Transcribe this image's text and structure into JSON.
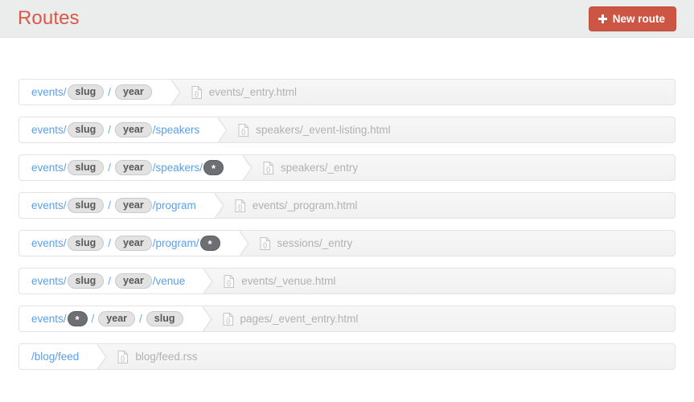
{
  "header": {
    "title": "Routes",
    "new_route_label": "New route",
    "plus_icon": "plus-icon",
    "accent_color": "#d9584a",
    "button_color": "#cd5543",
    "background_color": "#ebecec"
  },
  "icons": {
    "template_file": "template-file-icon",
    "wildcard": "*"
  },
  "routes": [
    {
      "segments": [
        {
          "type": "text",
          "value": "events/"
        },
        {
          "type": "var",
          "value": "slug"
        },
        {
          "type": "sep",
          "value": "/"
        },
        {
          "type": "var",
          "value": "year"
        }
      ],
      "template": "events/_entry.html"
    },
    {
      "segments": [
        {
          "type": "text",
          "value": "events/"
        },
        {
          "type": "var",
          "value": "slug"
        },
        {
          "type": "sep",
          "value": "/"
        },
        {
          "type": "var",
          "value": "year"
        },
        {
          "type": "text",
          "value": "/speakers"
        }
      ],
      "template": "speakers/_event-listing.html"
    },
    {
      "segments": [
        {
          "type": "text",
          "value": "events/"
        },
        {
          "type": "var",
          "value": "slug"
        },
        {
          "type": "sep",
          "value": "/"
        },
        {
          "type": "var",
          "value": "year"
        },
        {
          "type": "text",
          "value": "/speakers/"
        },
        {
          "type": "wild",
          "value": "*"
        }
      ],
      "template": "speakers/_entry"
    },
    {
      "segments": [
        {
          "type": "text",
          "value": "events/"
        },
        {
          "type": "var",
          "value": "slug"
        },
        {
          "type": "sep",
          "value": "/"
        },
        {
          "type": "var",
          "value": "year"
        },
        {
          "type": "text",
          "value": "/program"
        }
      ],
      "template": "events/_program.html"
    },
    {
      "segments": [
        {
          "type": "text",
          "value": "events/"
        },
        {
          "type": "var",
          "value": "slug"
        },
        {
          "type": "sep",
          "value": "/"
        },
        {
          "type": "var",
          "value": "year"
        },
        {
          "type": "text",
          "value": "/program/"
        },
        {
          "type": "wild",
          "value": "*"
        }
      ],
      "template": "sessions/_entry"
    },
    {
      "segments": [
        {
          "type": "text",
          "value": "events/"
        },
        {
          "type": "var",
          "value": "slug"
        },
        {
          "type": "sep",
          "value": "/"
        },
        {
          "type": "var",
          "value": "year"
        },
        {
          "type": "text",
          "value": "/venue"
        }
      ],
      "template": "events/_venue.html"
    },
    {
      "segments": [
        {
          "type": "text",
          "value": "events/"
        },
        {
          "type": "wild",
          "value": "*"
        },
        {
          "type": "sep",
          "value": "/"
        },
        {
          "type": "var",
          "value": "year"
        },
        {
          "type": "sep",
          "value": "/"
        },
        {
          "type": "var",
          "value": "slug"
        }
      ],
      "template": "pages/_event_entry.html"
    },
    {
      "segments": [
        {
          "type": "text",
          "value": "/blog/feed"
        }
      ],
      "template": "blog/feed.rss"
    }
  ]
}
